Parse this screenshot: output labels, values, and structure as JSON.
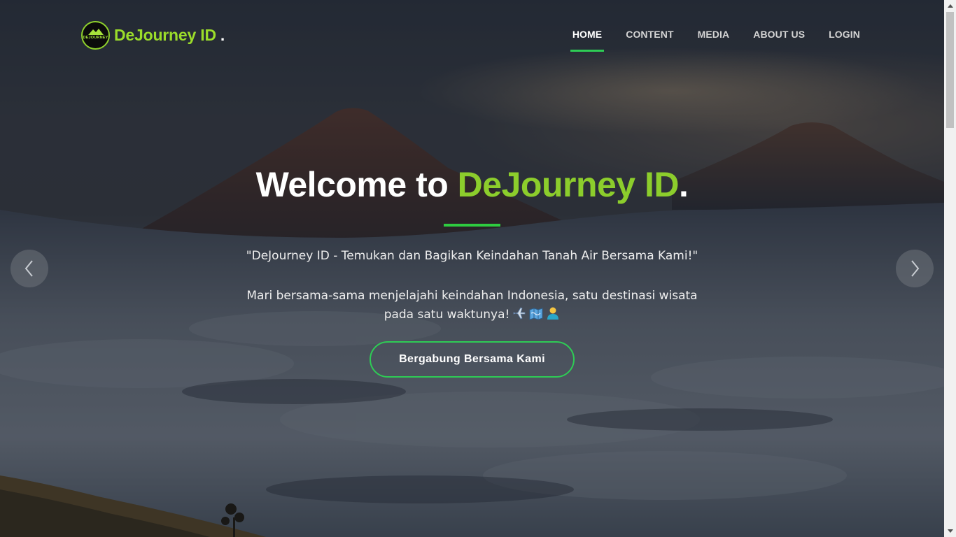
{
  "brand": {
    "name": "DeJourney ID",
    "dot": ".",
    "logo_text": "DEJOURNEY"
  },
  "nav": {
    "items": [
      {
        "label": "HOME",
        "active": true
      },
      {
        "label": "CONTENT"
      },
      {
        "label": "MEDIA"
      },
      {
        "label": "ABOUT US"
      },
      {
        "label": "LOGIN"
      }
    ]
  },
  "hero": {
    "title_prefix": "Welcome to ",
    "title_accent": "DeJourney ID",
    "title_suffix": ".",
    "quote": "\"DeJourney ID - Temukan dan Bagikan Keindahan Tanah Air Bersama Kami!\"",
    "desc_line1": "Mari bersama-sama menjelajahi keindahan Indonesia, satu destinasi wisata",
    "desc_line2": "pada satu waktunya!",
    "cta_label": "Bergabung Bersama Kami"
  },
  "icons": {
    "carousel_prev": "chevron-left-icon",
    "carousel_next": "chevron-right-icon",
    "emoji": [
      "airplane-emoji",
      "map-emoji",
      "person-emoji"
    ]
  },
  "colors": {
    "brand_green": "#9bdc2a",
    "accent_green": "#2ecc55",
    "title_accent": "#8ccd2c"
  }
}
